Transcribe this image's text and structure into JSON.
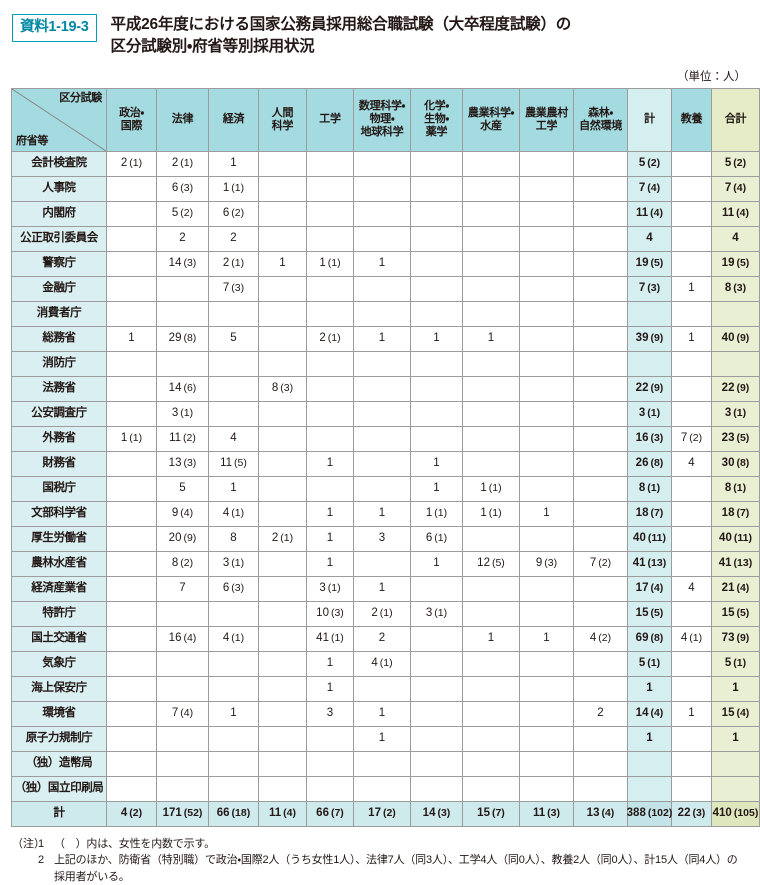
{
  "header": {
    "tag": "資料1-19-3",
    "title_line1": "平成26年度における国家公務員採用総合職試験（大卒程度試験）の",
    "title_line2": "区分試験別・府省等別採用状況",
    "unit_note": "（単位：人）"
  },
  "table": {
    "corner_top": "区分試験",
    "corner_bottom": "府省等",
    "columns": [
      {
        "key": "seiji",
        "label": "政治・\n国際"
      },
      {
        "key": "houritsu",
        "label": "法律"
      },
      {
        "key": "keizai",
        "label": "経済"
      },
      {
        "key": "ningen",
        "label": "人間\n科学"
      },
      {
        "key": "kougaku",
        "label": "工学"
      },
      {
        "key": "suuri",
        "label": "数理科学・\n物理・\n地球科学"
      },
      {
        "key": "kagaku",
        "label": "化学・\n生物・\n薬学"
      },
      {
        "key": "nougyo",
        "label": "農業科学・\n水産"
      },
      {
        "key": "nouson",
        "label": "農業農村\n工学"
      },
      {
        "key": "shinrin",
        "label": "森林・\n自然環境"
      },
      {
        "key": "kei",
        "label": "計"
      },
      {
        "key": "kyouyou",
        "label": "教養"
      },
      {
        "key": "gokei",
        "label": "合計"
      }
    ],
    "rows": [
      {
        "name": "会計検査院",
        "cells": [
          "2 (1)",
          "2 (1)",
          "1",
          "",
          "",
          "",
          "",
          "",
          "",
          "",
          "5 (2)",
          "",
          "5 (2)"
        ]
      },
      {
        "name": "人事院",
        "cells": [
          "",
          "6 (3)",
          "1 (1)",
          "",
          "",
          "",
          "",
          "",
          "",
          "",
          "7 (4)",
          "",
          "7 (4)"
        ]
      },
      {
        "name": "内閣府",
        "cells": [
          "",
          "5 (2)",
          "6 (2)",
          "",
          "",
          "",
          "",
          "",
          "",
          "",
          "11 (4)",
          "",
          "11 (4)"
        ]
      },
      {
        "name": "公正取引委員会",
        "cells": [
          "",
          "2",
          "2",
          "",
          "",
          "",
          "",
          "",
          "",
          "",
          "4",
          "",
          "4"
        ]
      },
      {
        "name": "警察庁",
        "cells": [
          "",
          "14 (3)",
          "2 (1)",
          "1",
          "1 (1)",
          "1",
          "",
          "",
          "",
          "",
          "19 (5)",
          "",
          "19 (5)"
        ]
      },
      {
        "name": "金融庁",
        "cells": [
          "",
          "",
          "7 (3)",
          "",
          "",
          "",
          "",
          "",
          "",
          "",
          "7 (3)",
          "1",
          "8 (3)"
        ]
      },
      {
        "name": "消費者庁",
        "cells": [
          "",
          "",
          "",
          "",
          "",
          "",
          "",
          "",
          "",
          "",
          "",
          "",
          ""
        ]
      },
      {
        "name": "総務省",
        "cells": [
          "1",
          "29 (8)",
          "5",
          "",
          "2 (1)",
          "1",
          "1",
          "1",
          "",
          "",
          "39 (9)",
          "1",
          "40 (9)"
        ]
      },
      {
        "name": "消防庁",
        "cells": [
          "",
          "",
          "",
          "",
          "",
          "",
          "",
          "",
          "",
          "",
          "",
          "",
          ""
        ]
      },
      {
        "name": "法務省",
        "cells": [
          "",
          "14 (6)",
          "",
          "8 (3)",
          "",
          "",
          "",
          "",
          "",
          "",
          "22 (9)",
          "",
          "22 (9)"
        ]
      },
      {
        "name": "公安調査庁",
        "cells": [
          "",
          "3 (1)",
          "",
          "",
          "",
          "",
          "",
          "",
          "",
          "",
          "3 (1)",
          "",
          "3 (1)"
        ]
      },
      {
        "name": "外務省",
        "cells": [
          "1 (1)",
          "11 (2)",
          "4",
          "",
          "",
          "",
          "",
          "",
          "",
          "",
          "16 (3)",
          "7 (2)",
          "23 (5)"
        ]
      },
      {
        "name": "財務省",
        "cells": [
          "",
          "13 (3)",
          "11 (5)",
          "",
          "1",
          "",
          "1",
          "",
          "",
          "",
          "26 (8)",
          "4",
          "30 (8)"
        ]
      },
      {
        "name": "国税庁",
        "cells": [
          "",
          "5",
          "1",
          "",
          "",
          "",
          "1",
          "1 (1)",
          "",
          "",
          "8 (1)",
          "",
          "8 (1)"
        ]
      },
      {
        "name": "文部科学省",
        "cells": [
          "",
          "9 (4)",
          "4 (1)",
          "",
          "1",
          "1",
          "1 (1)",
          "1 (1)",
          "1",
          "",
          "18 (7)",
          "",
          "18 (7)"
        ]
      },
      {
        "name": "厚生労働省",
        "cells": [
          "",
          "20 (9)",
          "8",
          "2 (1)",
          "1",
          "3",
          "6 (1)",
          "",
          "",
          "",
          "40 (11)",
          "",
          "40 (11)"
        ]
      },
      {
        "name": "農林水産省",
        "cells": [
          "",
          "8 (2)",
          "3 (1)",
          "",
          "1",
          "",
          "1",
          "12 (5)",
          "9 (3)",
          "7 (2)",
          "41 (13)",
          "",
          "41 (13)"
        ]
      },
      {
        "name": "経済産業省",
        "cells": [
          "",
          "7",
          "6 (3)",
          "",
          "3 (1)",
          "1",
          "",
          "",
          "",
          "",
          "17 (4)",
          "4",
          "21 (4)"
        ]
      },
      {
        "name": "特許庁",
        "cells": [
          "",
          "",
          "",
          "",
          "10 (3)",
          "2 (1)",
          "3 (1)",
          "",
          "",
          "",
          "15 (5)",
          "",
          "15 (5)"
        ]
      },
      {
        "name": "国土交通省",
        "cells": [
          "",
          "16 (4)",
          "4 (1)",
          "",
          "41 (1)",
          "2",
          "",
          "1",
          "1",
          "4 (2)",
          "69 (8)",
          "4 (1)",
          "73 (9)"
        ]
      },
      {
        "name": "気象庁",
        "cells": [
          "",
          "",
          "",
          "",
          "1",
          "4 (1)",
          "",
          "",
          "",
          "",
          "5 (1)",
          "",
          "5 (1)"
        ]
      },
      {
        "name": "海上保安庁",
        "cells": [
          "",
          "",
          "",
          "",
          "1",
          "",
          "",
          "",
          "",
          "",
          "1",
          "",
          "1"
        ]
      },
      {
        "name": "環境省",
        "cells": [
          "",
          "7 (4)",
          "1",
          "",
          "3",
          "1",
          "",
          "",
          "",
          "2",
          "14 (4)",
          "1",
          "15 (4)"
        ]
      },
      {
        "name": "原子力規制庁",
        "cells": [
          "",
          "",
          "",
          "",
          "",
          "1",
          "",
          "",
          "",
          "",
          "1",
          "",
          "1"
        ]
      },
      {
        "name": "（独）造幣局",
        "cells": [
          "",
          "",
          "",
          "",
          "",
          "",
          "",
          "",
          "",
          "",
          "",
          "",
          ""
        ]
      },
      {
        "name": "（独）国立印刷局",
        "cells": [
          "",
          "",
          "",
          "",
          "",
          "",
          "",
          "",
          "",
          "",
          "",
          "",
          ""
        ]
      }
    ],
    "total_row": {
      "name": "計",
      "cells": [
        "4 (2)",
        "171 (52)",
        "66 (18)",
        "11 (4)",
        "66 (7)",
        "17 (2)",
        "14 (3)",
        "15 (7)",
        "11 (3)",
        "13 (4)",
        "388 (102)",
        "22 (3)",
        "410 (105)"
      ]
    }
  },
  "notes": {
    "lead": "（注）",
    "items": [
      {
        "num": "1",
        "text": "（　）内は、女性を内数で示す。"
      },
      {
        "num": "2",
        "text": "上記のほか、防衛省（特別職）で政治・国際2人（うち女性1人）、法律7人（同3人）、工学4人（同0人）、教養2人（同0人）、計15人（同4人）の採用者がいる。"
      }
    ]
  },
  "colors": {
    "tag_border": "#00A0B9",
    "header_bg": "#a3dbe0",
    "rowhead_bg": "#d9eff1",
    "total_col_bg": "#d5eef0",
    "grand_col_bg": "#e9efd2"
  }
}
